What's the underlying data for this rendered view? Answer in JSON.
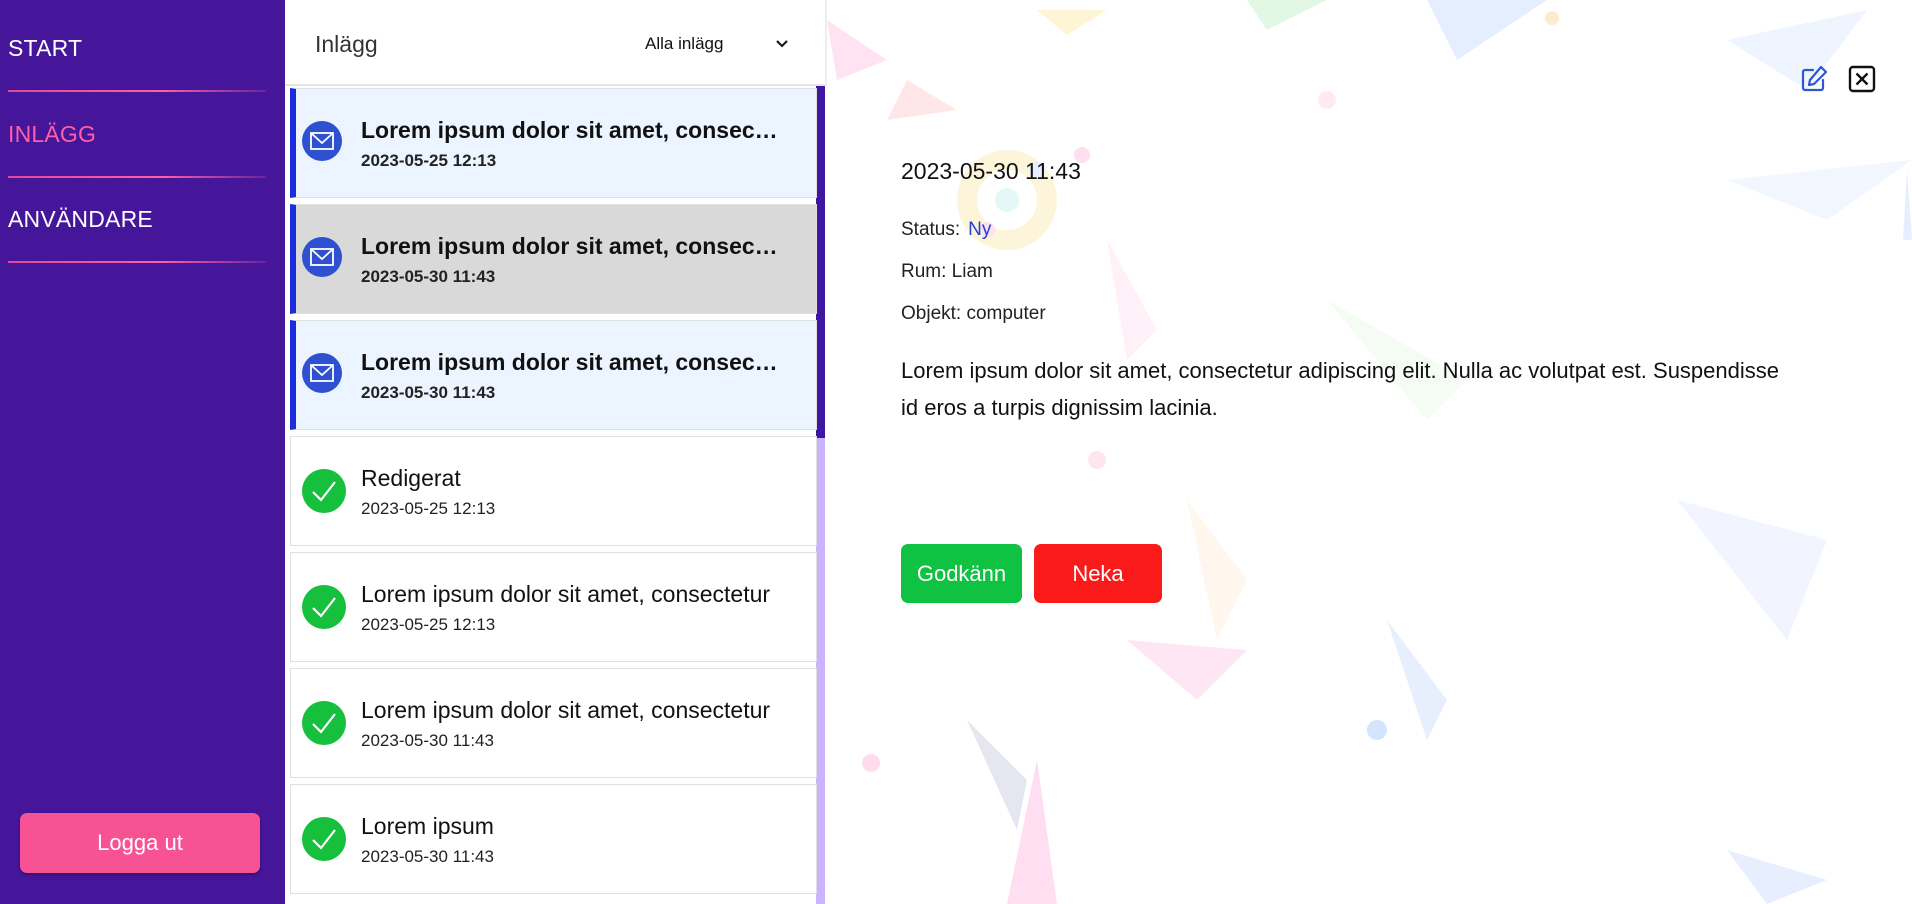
{
  "sidebar": {
    "nav": [
      {
        "label": "START",
        "active": false
      },
      {
        "label": "INLÄGG",
        "active": true
      },
      {
        "label": "ANVÄNDARE",
        "active": false
      }
    ],
    "logout_label": "Logga ut"
  },
  "list": {
    "title": "Inlägg",
    "filter": {
      "selected": "Alla inlägg"
    },
    "items": [
      {
        "title": "Lorem ipsum dolor sit amet, consectetur",
        "date": "2023-05-25 12:13",
        "state": "unread",
        "icon": "envelope-icon"
      },
      {
        "title": "Lorem ipsum dolor sit amet, consectetur",
        "date": "2023-05-30 11:43",
        "state": "selected",
        "icon": "envelope-icon"
      },
      {
        "title": "Lorem ipsum dolor sit amet, consectetur",
        "date": "2023-05-30 11:43",
        "state": "unread",
        "icon": "envelope-icon"
      },
      {
        "title": "Redigerat",
        "date": "2023-05-25 12:13",
        "state": "read",
        "icon": "check-icon"
      },
      {
        "title": "Lorem ipsum dolor sit amet, consectetur",
        "date": "2023-05-25 12:13",
        "state": "read",
        "icon": "check-icon"
      },
      {
        "title": "Lorem ipsum dolor sit amet, consectetur",
        "date": "2023-05-30 11:43",
        "state": "read",
        "icon": "check-icon"
      },
      {
        "title": "Lorem ipsum",
        "date": "2023-05-30 11:43",
        "state": "read",
        "icon": "check-icon"
      }
    ]
  },
  "detail": {
    "date": "2023-05-30 11:43",
    "status_label": "Status:",
    "status_value": "Ny",
    "room": "Rum: Liam",
    "object": "Objekt: computer",
    "body": "Lorem ipsum dolor sit amet, consectetur adipiscing elit. Nulla ac volutpat est. Suspendisse id eros a turpis dignissim lacinia.",
    "approve_label": "Godkänn",
    "deny_label": "Neka"
  },
  "colors": {
    "sidebar_bg": "#45159a",
    "accent_pink": "#ff5ea8",
    "unread_border": "#1a2ee0",
    "approve": "#0fc242",
    "deny": "#fb1a1a",
    "status": "#1f44d6"
  }
}
